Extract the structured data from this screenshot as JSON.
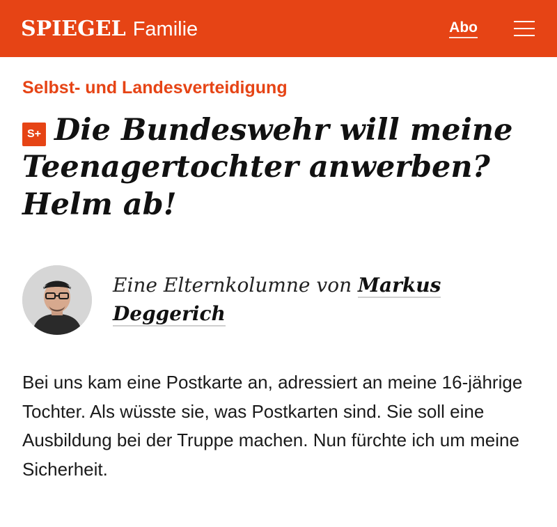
{
  "header": {
    "logo_text": "SPIEGEL",
    "section": "Familie",
    "abo_label": "Abo",
    "menu_icon": "hamburger-menu-icon",
    "background_color": "#e64415"
  },
  "article": {
    "kicker": "Selbst- und Landesverteidigung",
    "badge": "S+",
    "headline": "Die Bundeswehr will meine Teenagertochter anwerben? Helm ab!",
    "byline_prefix": "Eine Elternkolumne von",
    "author": "Markus Deggerich",
    "teaser": "Bei uns kam eine Postkarte an, adressiert an meine 16-jährige Tochter. Als wüsste sie, was Postkarten sind. Sie soll eine Ausbildung bei der Truppe machen. Nun fürchte ich um meine Sicherheit."
  },
  "colors": {
    "accent": "#e64415",
    "text": "#1a1a1a"
  }
}
